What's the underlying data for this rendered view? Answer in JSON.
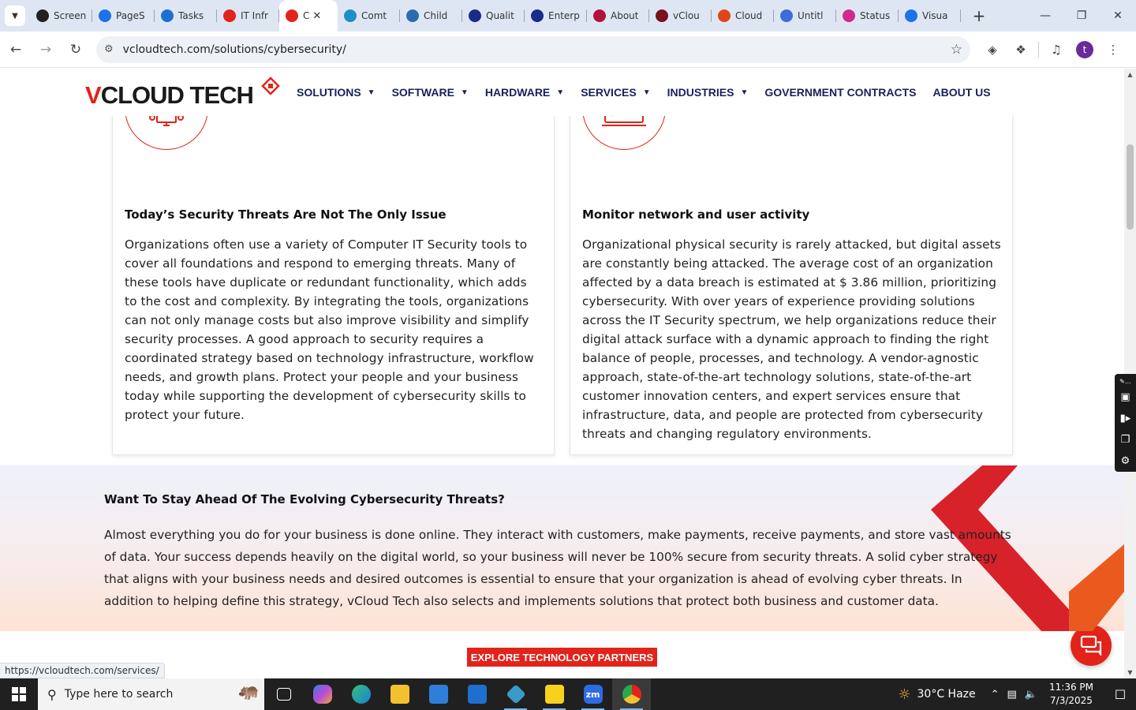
{
  "browser": {
    "tabs": [
      {
        "title": "Screen",
        "icon": "obs-icon",
        "color": "#222222"
      },
      {
        "title": "PageS",
        "icon": "pagespeed-icon",
        "color": "#1a73e8"
      },
      {
        "title": "Tasks",
        "icon": "tasks-icon",
        "color": "#1e6fd0"
      },
      {
        "title": "IT Infr",
        "icon": "vcloud-icon",
        "color": "#e2231a"
      },
      {
        "title": "C",
        "icon": "vcloud-icon",
        "color": "#e2231a",
        "active": true
      },
      {
        "title": "Comt",
        "icon": "edge-icon",
        "color": "#1f8fc7"
      },
      {
        "title": "Child",
        "icon": "scales-icon",
        "color": "#2b6cb0"
      },
      {
        "title": "Qualit",
        "icon": "x-icon",
        "color": "#1b2b8c"
      },
      {
        "title": "Enterp",
        "icon": "check-icon",
        "color": "#1b2b8c"
      },
      {
        "title": "About",
        "icon": "about-icon",
        "color": "#b0123a"
      },
      {
        "title": "vClou",
        "icon": "v-icon",
        "color": "#7a1020"
      },
      {
        "title": "Cloud",
        "icon": "cloud-icon",
        "color": "#e0451a"
      },
      {
        "title": "Untitl",
        "icon": "docs-icon",
        "color": "#3b6fd6"
      },
      {
        "title": "Status",
        "icon": "status-icon",
        "color": "#d12a8a"
      },
      {
        "title": "Visua",
        "icon": "visual-icon",
        "color": "#1a73e8"
      }
    ],
    "url": "vcloudtech.com/solutions/cybersecurity/",
    "profile_initial": "t",
    "status_url": "https://vcloudtech.com/services/"
  },
  "site": {
    "logo": {
      "v": "V",
      "rest": "CLOUD TECH"
    },
    "nav": [
      "SOLUTIONS",
      "SOFTWARE",
      "HARDWARE",
      "SERVICES",
      "INDUSTRIES",
      "GOVERNMENT CONTRACTS",
      "ABOUT US"
    ],
    "nav_dropdown": [
      true,
      true,
      true,
      true,
      true,
      false,
      false
    ],
    "accent_color": "#e2231a",
    "nav_color": "#1b1f5c"
  },
  "cards": [
    {
      "title": "Today’s Security Threats Are Not The Only Issue",
      "lines": [
        "Organizations often use a variety of Computer IT Security tools to",
        "cover all foundations and respond to emerging threats. Many of",
        "these tools have duplicate or redundant functionality, which adds",
        "to the cost and complexity. By integrating the tools, organizations",
        "can not only manage costs but also improve visibility and simplify",
        "security processes. A good approach to security requires a",
        "coordinated strategy based on technology infrastructure, workflow",
        "needs, and growth plans. Protect your people and your business",
        "today while supporting the development of cybersecurity skills to",
        "protect your future."
      ]
    },
    {
      "title": "Monitor network and user activity",
      "lines": [
        "Organizational physical security is rarely attacked, but digital assets",
        "are constantly being attacked. The average cost of an organization",
        "affected by a data breach is estimated at $ 3.86 million, prioritizing",
        "cybersecurity. With over years of experience providing solutions",
        "across the IT Security spectrum, we help organizations reduce their",
        "digital attack surface with a dynamic approach to finding the right",
        "balance of people, processes, and technology. A vendor-agnostic",
        "approach, state-of-the-art technology solutions, state-of-the-art",
        "customer innovation centers, and expert services ensure that",
        "infrastructure, data, and people are protected from cybersecurity",
        "threats and changing regulatory environments."
      ]
    }
  ],
  "band": {
    "title": "Want To Stay Ahead Of The Evolving Cybersecurity Threats?",
    "lines": [
      "Almost everything you do for your business is done online. They interact with customers, make payments, receive payments, and store vast amounts",
      "of data. Your success depends heavily on the digital world, so your business will never be 100% secure from security threats. A solid cyber strategy",
      "that aligns with your business needs and desired outcomes is essential to ensure that your organization is ahead of evolving cyber threats. In",
      "addition to helping define this strategy, vCloud Tech also selects and implements solutions that protect both business and customer data."
    ]
  },
  "cta_label": "EXPLORE TECHNOLOGY PARTNERS",
  "taskbar": {
    "search_placeholder": "Type here to search",
    "weather": "30°C  Haze",
    "time": "11:36 PM",
    "date": "7/3/2025"
  }
}
